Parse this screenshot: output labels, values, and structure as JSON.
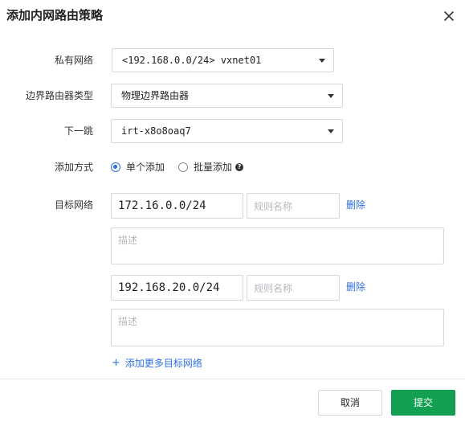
{
  "dialog": {
    "title": "添加内网路由策略"
  },
  "form": {
    "vpc": {
      "label": "私有网络",
      "value": "<192.168.0.0/24> vxnet01"
    },
    "border_router_type": {
      "label": "边界路由器类型",
      "value": "物理边界路由器"
    },
    "next_hop": {
      "label": "下一跳",
      "value": "irt-x8o8oaq7"
    },
    "add_mode": {
      "label": "添加方式",
      "options": [
        {
          "label": "单个添加",
          "selected": true
        },
        {
          "label": "批量添加",
          "selected": false
        }
      ],
      "help_icon": "question-circle-icon"
    },
    "target_network": {
      "label": "目标网络",
      "entries": [
        {
          "cidr": "172.16.0.0/24",
          "rule_name_placeholder": "规则名称",
          "delete_label": "删除",
          "description_placeholder": "描述"
        },
        {
          "cidr": "192.168.20.0/24",
          "rule_name_placeholder": "规则名称",
          "delete_label": "删除",
          "description_placeholder": "描述"
        }
      ],
      "add_more_label": "添加更多目标网络"
    }
  },
  "footer": {
    "cancel_label": "取消",
    "submit_label": "提交"
  },
  "colors": {
    "primary": "#13a052",
    "link": "#2f6fe0",
    "border": "#d5d8dc"
  }
}
